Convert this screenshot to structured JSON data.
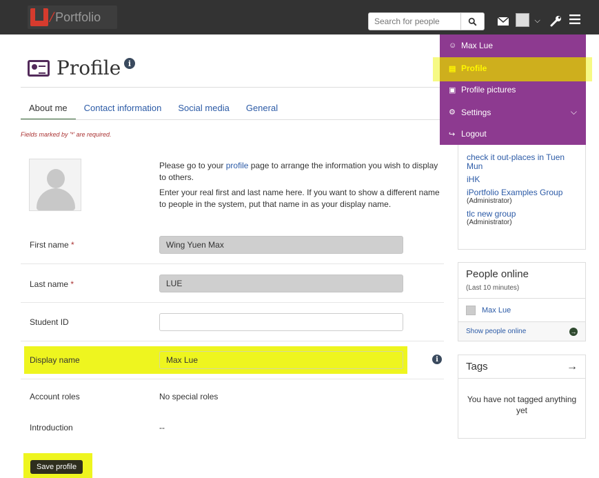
{
  "header": {
    "logo_text": "Portfolio",
    "search_placeholder": "Search for people"
  },
  "page": {
    "title": "Profile"
  },
  "tabs": [
    {
      "label": "About me",
      "active": true
    },
    {
      "label": "Contact information"
    },
    {
      "label": "Social media"
    },
    {
      "label": "General"
    }
  ],
  "required_note": "Fields marked by '*' are required.",
  "intro": {
    "line1_pre": "Please go to your ",
    "line1_link": "profile",
    "line1_post": " page to arrange the information you wish to display to others.",
    "line2": "Enter your real first and last name here. If you want to show a different name to people in the system, put that name in as your display name."
  },
  "form": {
    "first_name_label": "First name",
    "first_name_value": "Wing Yuen Max",
    "last_name_label": "Last name",
    "last_name_value": "LUE",
    "student_id_label": "Student ID",
    "student_id_value": "",
    "display_name_label": "Display name",
    "display_name_value": "Max Lue",
    "required_mark": "*",
    "account_roles_label": "Account roles",
    "account_roles_value": "No special roles",
    "introduction_label": "Introduction",
    "introduction_value": "--",
    "save_label": "Save profile"
  },
  "groups": [
    {
      "name": "check it out-places in Tuen Mun",
      "role": ""
    },
    {
      "name": "iHK",
      "role": ""
    },
    {
      "name": "iPortfolio Examples Group",
      "role": "(Administrator)"
    },
    {
      "name": "tlc new group",
      "role": "(Administrator)"
    }
  ],
  "people_online": {
    "title": "People online",
    "subtitle": "(Last 10 minutes)",
    "user": "Max Lue",
    "show_link": "Show people online"
  },
  "tags": {
    "title": "Tags",
    "empty": "You have not tagged anything yet"
  },
  "user_menu": {
    "items": [
      {
        "label": "Max Lue",
        "icon": "user-icon"
      },
      {
        "label": "Profile",
        "icon": "id-card-icon",
        "active": true
      },
      {
        "label": "Profile pictures",
        "icon": "portrait-icon"
      },
      {
        "label": "Settings",
        "icon": "cogs-icon"
      },
      {
        "label": "Logout",
        "icon": "sign-out-icon"
      }
    ]
  },
  "colors": {
    "header_bg": "#333333",
    "menu_bg": "#8d3a90",
    "highlight": "#eef51f",
    "link": "#2b5aa6",
    "required": "#aa3333"
  }
}
